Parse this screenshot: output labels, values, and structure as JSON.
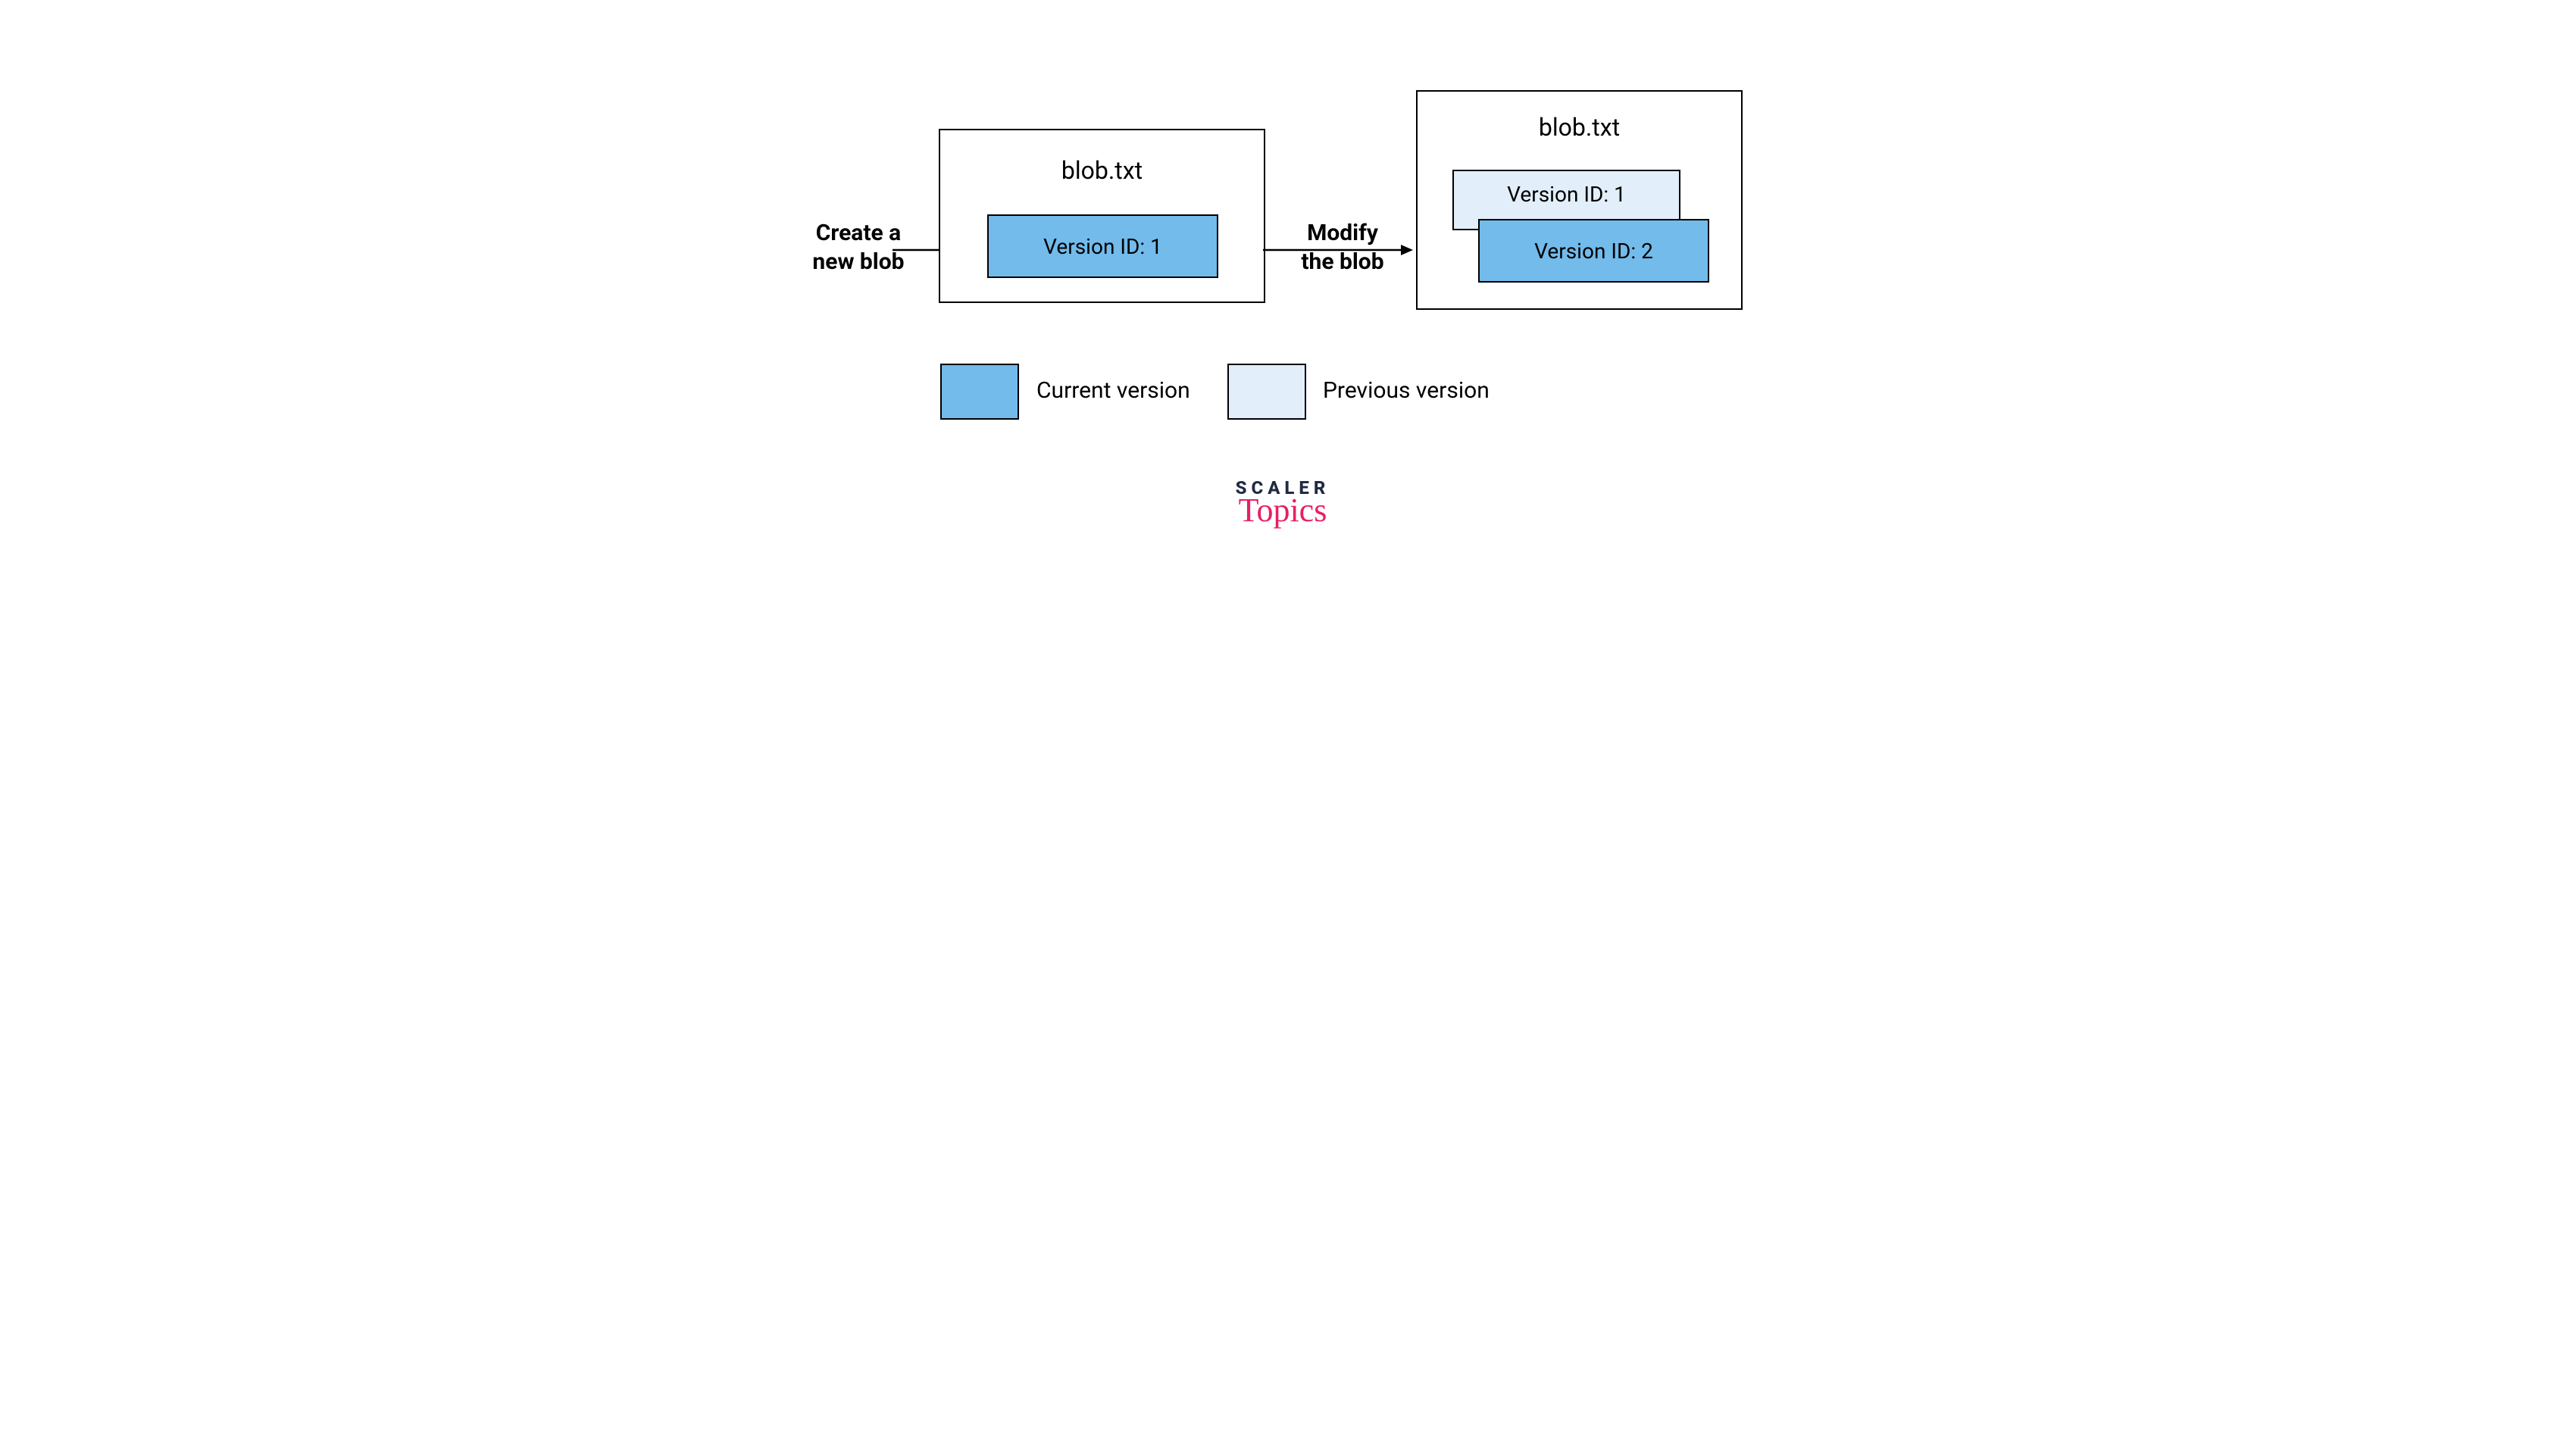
{
  "labels": {
    "create": "Create a\nnew blob",
    "modify": "Modify\nthe blob"
  },
  "blob1": {
    "title": "blob.txt",
    "version_current": "Version ID: 1"
  },
  "blob2": {
    "title": "blob.txt",
    "version_previous": "Version ID: 1",
    "version_current": "Version ID: 2"
  },
  "legend": {
    "current": "Current version",
    "previous": "Previous version"
  },
  "logo": {
    "line1": "SCALER",
    "line2": "Topics"
  },
  "colors": {
    "current": "#72BBEB",
    "previous": "#E2EFFA",
    "accent": "#E91E63"
  }
}
